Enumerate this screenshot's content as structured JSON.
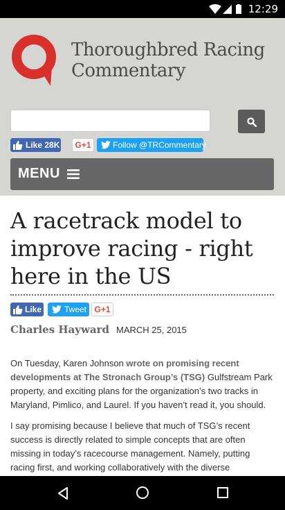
{
  "status_bar": {
    "time": "12:29"
  },
  "site": {
    "title_line1": "Thoroughbred Racing",
    "title_line2": "Commentary"
  },
  "search": {
    "placeholder": ""
  },
  "social": {
    "fb_like": "Like 28K",
    "gplus": "G+1",
    "twitter_follow": "Follow @TRCommentary"
  },
  "menu": {
    "label": "MENU"
  },
  "article": {
    "title": "A racetrack model to improve racing - right here in the US",
    "share": {
      "like": "Like",
      "tweet": "Tweet",
      "gplus": "G+1"
    },
    "author": "Charles Hayward",
    "date": "MARCH 25, 2015",
    "p1": {
      "t1": "On Tuesday, Karen Johnson ",
      "link1": "wrote on promising recent developments at The Stronach Group’s (TSG)",
      "t2": " Gulfstream Park property, and exciting plans for the organization’s two tracks in Maryland, Pimlico, and Laurel. If you haven’t read it, you should."
    },
    "p2": "I say promising because I believe that much of TSG’s recent success is directly related to simple concepts that are often missing in today’s racecourse management. Namely, putting racing first, and working collaboratively with the diverse"
  },
  "colors": {
    "header_bg": "#d5d5d1",
    "logo_red": "#d9302c",
    "menu_bg": "#666666",
    "fb": "#4267b2",
    "twitter": "#1da1f2"
  },
  "icons": [
    "wifi-icon",
    "signal-icon",
    "battery-icon",
    "search-icon",
    "thumbs-up-icon",
    "twitter-bird-icon",
    "hamburger-icon",
    "back-icon",
    "home-icon",
    "recents-icon"
  ]
}
